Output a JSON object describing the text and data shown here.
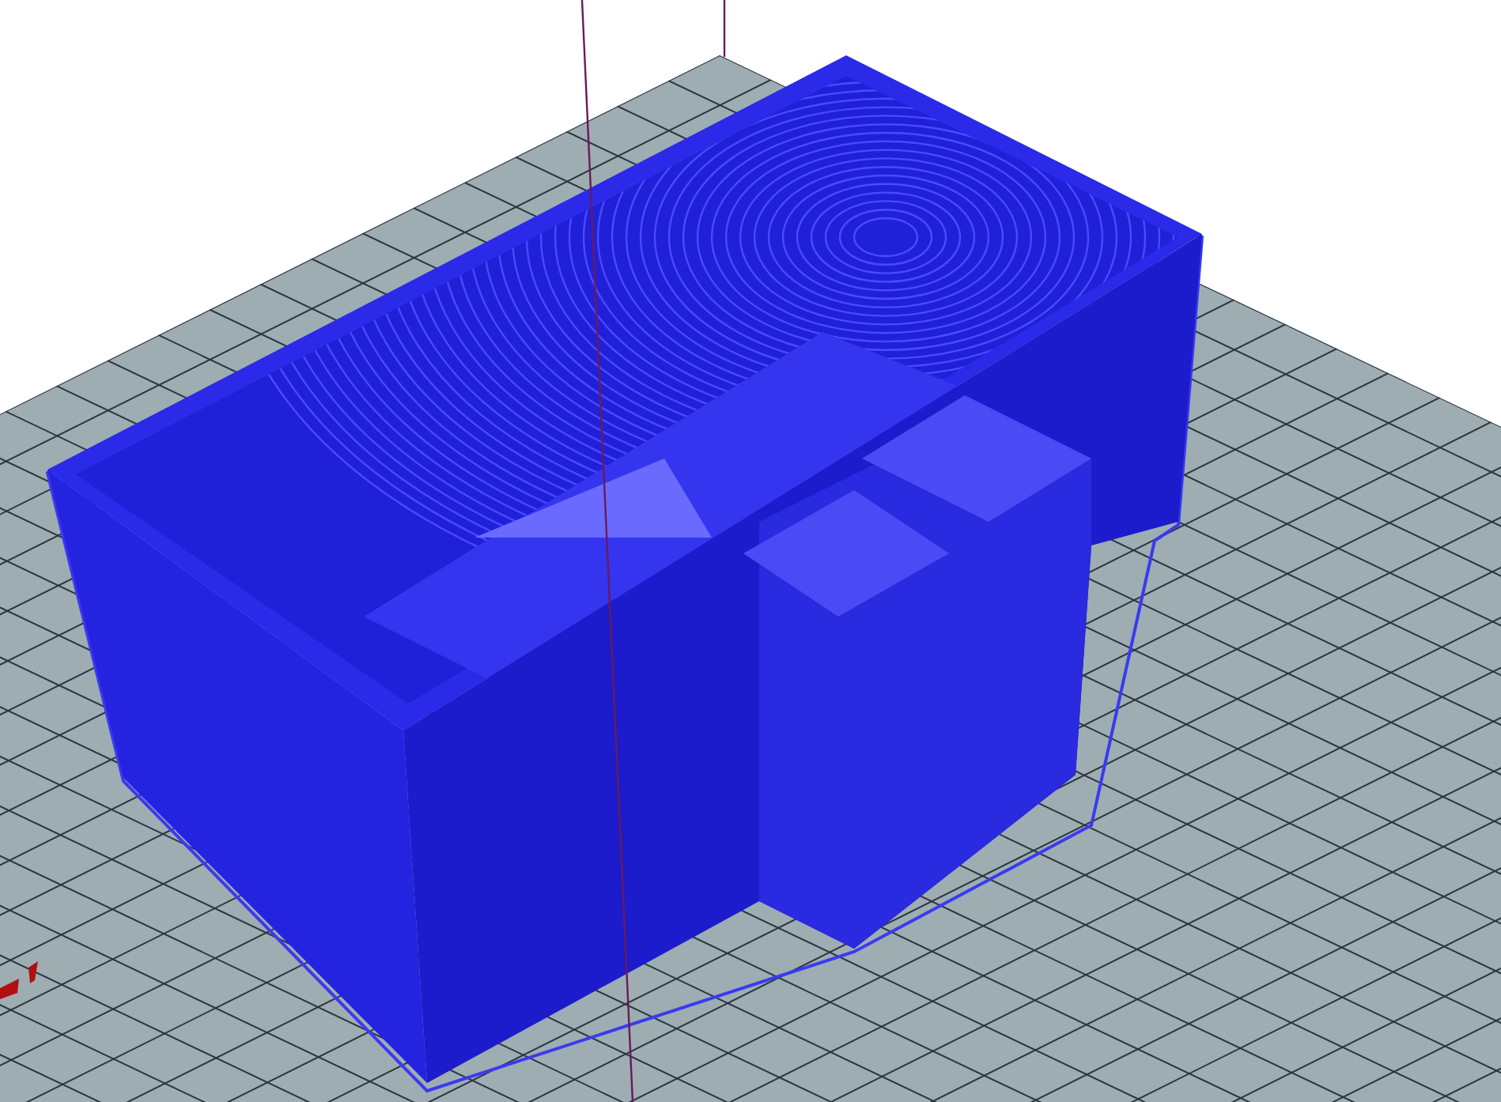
{
  "viewport": {
    "kind": "sliced-model"
  }
}
